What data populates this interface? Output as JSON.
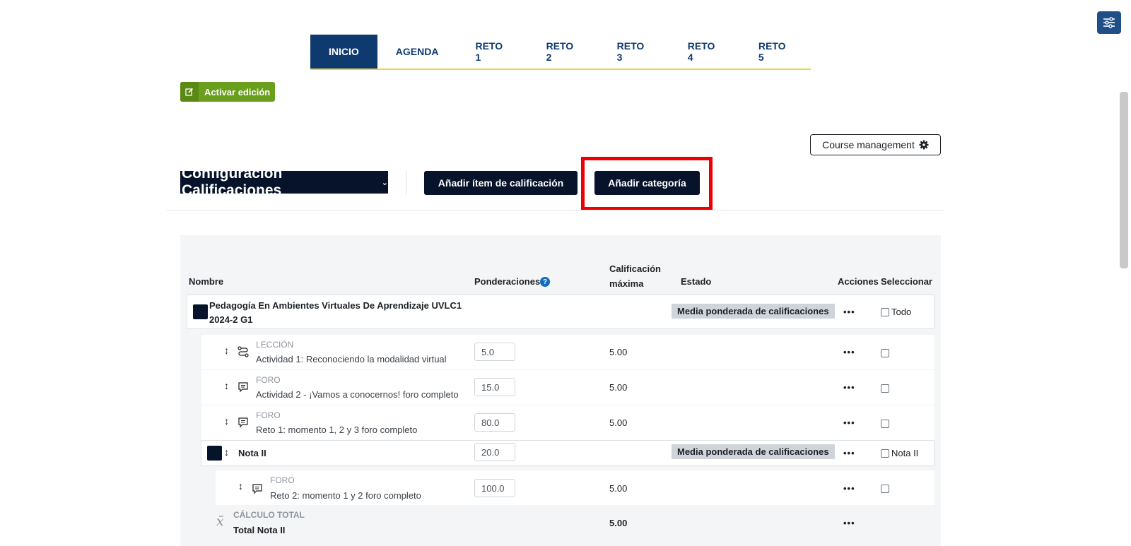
{
  "nav": {
    "tabs": [
      "INICIO",
      "AGENDA",
      "RETO 1",
      "RETO 2",
      "RETO 3",
      "RETO 4",
      "RETO 5"
    ],
    "active_index": 0
  },
  "edit_button": {
    "label": "Activar edición"
  },
  "course_management": {
    "label": "Course management"
  },
  "page_header": {
    "title": "Configuración Calificaciones",
    "add_item_label": "Añadir ítem de calificación",
    "add_category_label": "Añadir categoría"
  },
  "table": {
    "headers": {
      "name": "Nombre",
      "weights": "Ponderaciones",
      "max_grade_line1": "Calificación",
      "max_grade_line2": "máxima",
      "status": "Estado",
      "actions": "Acciones",
      "select": "Seleccionar"
    },
    "course_category": {
      "name_line1": "Pedagogía En Ambientes Virtuales De Aprendizaje UVLC1",
      "name_line2": "2024-2 G1",
      "status": "Media ponderada de calificaciones",
      "actions": "•••",
      "select_label": "Todo"
    },
    "items": [
      {
        "module": "LECCIÓN",
        "name": "Actividad 1: Reconociendo la modalidad virtual",
        "weight": "5.0",
        "max": "5.00",
        "actions": "•••"
      },
      {
        "module": "FORO",
        "name": "Actividad 2 - ¡Vamos a conocernos! foro completo",
        "weight": "15.0",
        "max": "5.00",
        "actions": "•••"
      },
      {
        "module": "FORO",
        "name": "Reto 1: momento 1, 2 y 3 foro completo",
        "weight": "80.0",
        "max": "5.00",
        "actions": "•••"
      }
    ],
    "subcategory": {
      "name": "Nota II",
      "weight": "20.0",
      "status": "Media ponderada de calificaciones",
      "actions": "•••",
      "select_label": "Nota II"
    },
    "sub_items": [
      {
        "module": "FORO",
        "name": "Reto 2: momento 1 y 2 foro completo",
        "weight": "100.0",
        "max": "5.00",
        "actions": "•••"
      }
    ],
    "total": {
      "label": "CÁLCULO TOTAL",
      "name": "Total Nota II",
      "max": "5.00",
      "actions": "•••"
    }
  },
  "colors": {
    "brand_dark": "#06132a",
    "nav_blue": "#0f3a70",
    "accent_yellow": "#e7d44a",
    "edit_green": "#6a9f1d",
    "highlight_red": "#ee0000"
  }
}
